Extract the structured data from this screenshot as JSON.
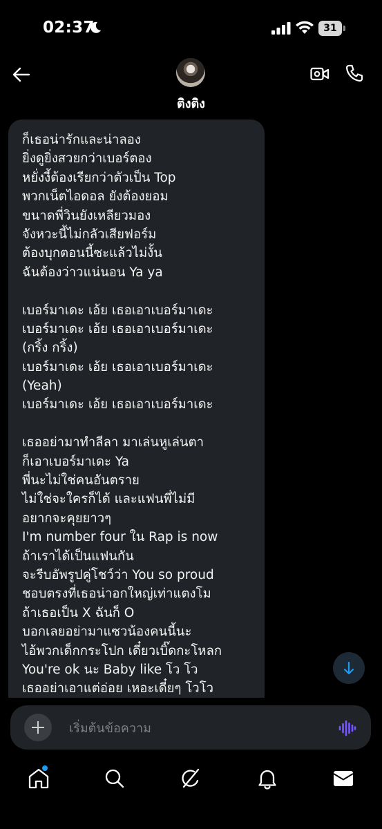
{
  "status_bar": {
    "time": "02:37",
    "battery": "31"
  },
  "header": {
    "contact_name": "ติงติง"
  },
  "message": {
    "lines": [
      "ก็เธอน่ารักและน่าลอง",
      "ยิ่งดูยิ่งสวยกว่าเบอร์ตอง",
      "หยั่งงี้ต้องเรียกว่าตัวเป็น Top",
      "พวกเน็ตไอดอล ยังต้องยอม",
      "ขนาดพี่วินยังเหลียวมอง",
      "จังหวะนี้ไม่กลัวเสียฟอร์ม",
      "ต้องบุกตอนนี้ซะแล้วไม่งั้น",
      "ฉันต้องว่าวแน่นอน Ya ya",
      "",
      "เบอร์มาเดะ เอ้ย เธอเอาเบอร์มาเดะ",
      "เบอร์มาเดะ เอ้ย เธอเอาเบอร์มาเดะ",
      "(กริ้ง กริ้ง)",
      "เบอร์มาเดะ เอ้ย เธอเอาเบอร์มาเดะ",
      "(Yeah)",
      "เบอร์มาเดะ เอ้ย เธอเอาเบอร์มาเดะ",
      "",
      "เธออย่ามาทำลีลา มาเล่นหูเล่นตา",
      "ก็เอาเบอร์มาเดะ Ya",
      "พี่นะไม่ใช่คนอันตราย",
      "ไม่ใช่จะใครก็ได้ และแฟนพี่ไม่มี",
      "อยากจะคุยยาวๆ",
      "I'm number four ใน Rap is now",
      "ถ้าเราได้เป็นแฟนกัน",
      "จะรีบอัพรูปคู่โชว์ว่า You so proud",
      "ชอบตรงที่เธอน่าอกใหญ่เท่าแตงโม",
      "ถ้าเธอเป็น X ฉันก็ O",
      "บอกเลยอย่ามาแซวน้องคนนี้นะ",
      "ไอ้พวกเด็กกระโปก เดี๋ยวเบิ๊ดกะโหลก",
      "You're ok นะ Baby like โว โว",
      "เธออย่าเอาแต่อ่อย เหอะเดี๋ยๆ โวโว"
    ]
  },
  "composer": {
    "placeholder": "เริ่มต้นข้อความ"
  },
  "tabs": [
    "home-tab",
    "search-tab",
    "grok-tab",
    "notifications-tab",
    "messages-tab"
  ],
  "colors": {
    "accent": "#1d9bf0",
    "voice_accent": "#7856ff",
    "bubble": "#202327"
  }
}
